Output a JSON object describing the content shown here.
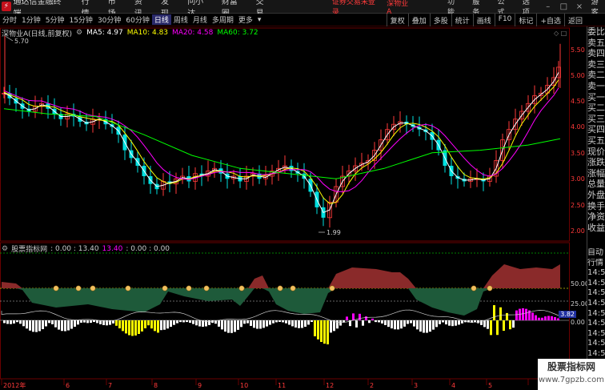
{
  "app": {
    "title": "通达信金融终端",
    "menu": [
      "行情",
      "市场",
      "资讯",
      "发现",
      "问小达",
      "财富圈",
      "交易"
    ],
    "notice": "证券交易未登录",
    "stock_name": "深物业A",
    "right_menu": [
      "功能",
      "服务",
      "公式",
      "选项"
    ],
    "guest": "游客"
  },
  "periods": [
    "分时",
    "1分钟",
    "5分钟",
    "15分钟",
    "30分钟",
    "60分钟",
    "日线",
    "周线",
    "月线",
    "多周期",
    "更多"
  ],
  "active_period": "日线",
  "right_tools": [
    "复权",
    "叠加",
    "多股",
    "统计",
    "画线",
    "F10",
    "标记",
    "+自选",
    "返回"
  ],
  "info": {
    "name": "深物业A(日线,前复权)",
    "ma5": "MA5: 4.97",
    "ma10": "MA10: 4.83",
    "ma20": "MA20: 4.58",
    "ma60": "MA60: 3.72"
  },
  "indicator": {
    "name": "股票指标网",
    "values": ": 0.00 : 13.40",
    "v2": "13.40",
    "v3": ": 0.00 : 0.00"
  },
  "price_axis": [
    "5.50",
    "5.00",
    "4.50",
    "4.00",
    "3.50",
    "3.00",
    "2.50",
    "2.00"
  ],
  "price_labels": {
    "high": "5.70",
    "low": "1.99"
  },
  "ind_axis": [
    "50.00",
    "25.00",
    "0.00"
  ],
  "ind_value": "3.82",
  "time_axis": [
    "2012年",
    "6",
    "7",
    "8",
    "9",
    "10",
    "11",
    "12",
    "2",
    "3",
    "4",
    "5"
  ],
  "right_panel_items": [
    "委比",
    "卖五",
    "卖四",
    "卖三",
    "卖二",
    "卖一",
    "买一",
    "买二",
    "买三",
    "买四",
    "买五",
    "现价",
    "涨跌",
    "涨幅",
    "总量",
    "外盘",
    "换手",
    "净资",
    "收益"
  ],
  "right_panel_lower": [
    "自动",
    "行情",
    "14:56",
    "14:56",
    "14:56",
    "14:56",
    "14:56",
    "14:56",
    "14:56",
    "14:56",
    "14:56",
    "14:56"
  ],
  "watermark": {
    "line1": "股票指标网",
    "line2": "www.7gpzb.com"
  },
  "colors": {
    "up": "#ff3a3a",
    "down": "#00ffff",
    "ma5": "#ffffff",
    "ma10": "#ffff00",
    "ma20": "#ff00ff",
    "ma60": "#00ff00"
  }
}
